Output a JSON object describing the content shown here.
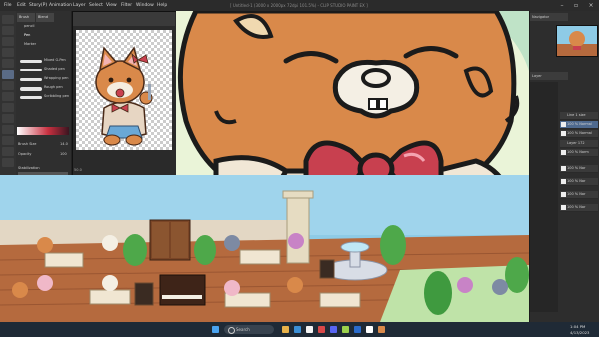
{
  "menubar": {
    "items": [
      "File",
      "Edit",
      "Story(P)",
      "Animation",
      "Layer",
      "Select",
      "View",
      "Filter",
      "Window",
      "Help"
    ],
    "title": "[ Untitled-1 (3000 x 2000px 72dpi 101.5%) - CLIP STUDIO PAINT EX ]"
  },
  "subtool": {
    "tabs": [
      "Brush",
      "Blend"
    ],
    "list_left": [
      "pencil",
      "Pen",
      "Marker"
    ],
    "brushes": [
      "Mixed G-Pen",
      "Shaded pen",
      "Wrapping pen",
      "Rough pen",
      "Scribbling pen"
    ],
    "properties": [
      "Brush Size",
      "Opacity",
      "Stabilization",
      "Ink rounding"
    ],
    "brush_size_value": "14.0",
    "opacity_value": "100"
  },
  "reference": {
    "status": "50.0"
  },
  "right": {
    "navigator_tab": "Navigator",
    "layer_tab": "Layer",
    "layers": [
      "Line 1 size",
      "100 % Normal",
      "100 % Normal",
      "Layer 172",
      "100 % Norm",
      "100 % Nor",
      "100 % Nor",
      "100 % Nor",
      "100 % Nor"
    ]
  },
  "game": {
    "coins": "186384B"
  },
  "taskbar": {
    "search": "Search",
    "time": "1:04 PM",
    "date": "4/13/2023"
  },
  "colors": {
    "cat_orange": "#d9894a",
    "bow_red": "#c8404f",
    "canvas_bg": "#eef6dd",
    "game_floor": "#b56a3e"
  }
}
